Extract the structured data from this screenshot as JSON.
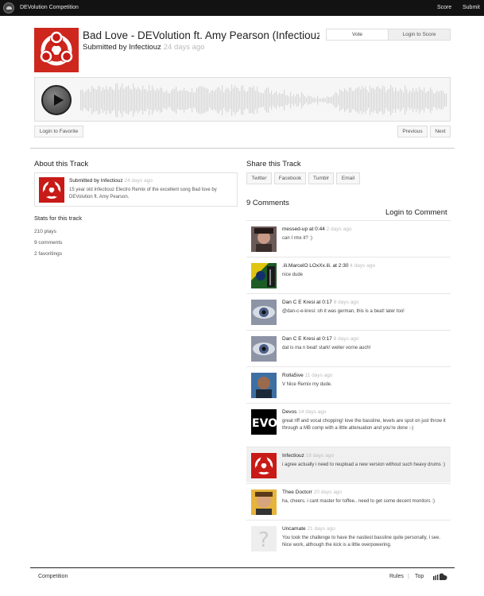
{
  "topbar": {
    "title": "DEVolution Competition",
    "score": "Score",
    "submit": "Submit"
  },
  "track": {
    "title": "Bad Love - DEVolution ft. Amy Pearson (Infectiouz",
    "submitted_by": "Submitted by Infectiouz",
    "submitted_ago": "24 days ago"
  },
  "vote_box": {
    "vote": "Vote",
    "login_score": "Login to Score"
  },
  "player": {
    "favorite": "Login to Favorite",
    "previous": "Previous",
    "next": "Next"
  },
  "about": {
    "heading": "About this Track",
    "who": "Submitted by Infectiouz",
    "ago": "24 days ago",
    "description": "15 year old Infectiouz Electro Remix of the excellent song Bad love by DEVolution ft. Amy Pearson."
  },
  "stats": {
    "heading": "Stats for this track",
    "plays": "210 plays",
    "comments": "9 comments",
    "favoritings": "2 favoritings"
  },
  "share": {
    "heading": "Share this Track",
    "twitter": "Twitter",
    "facebook": "Facebook",
    "tumblr": "Tumblr",
    "email": "Email"
  },
  "comments_section": {
    "heading": "9 Comments",
    "login": "Login to Comment"
  },
  "comments": [
    {
      "who": "messed-up at 0:44",
      "ago": "2 days ago",
      "text": "can I rmx it? :)"
    },
    {
      "who": ".ili.MarcelO LOxXx.ili. at 2:30",
      "ago": "4 days ago",
      "text": "nice dude"
    },
    {
      "who": "Dan C E Kresi at 0:17",
      "ago": "8 days ago",
      "text": "@dan-c-e-kresi: oh it was german, this is a beat! later too!"
    },
    {
      "who": "Dan C E Kresi at 0:17",
      "ago": "8 days ago",
      "text": "dat is ma n beat! stark! weiter vorne auch!"
    },
    {
      "who": "Rolla5ive",
      "ago": "11 days ago",
      "text": "V Nice Remix my dude."
    },
    {
      "who": "Devos",
      "ago": "14 days ago",
      "text": "great riff and vocal chopping! love the bassline, levels are spot on just throw it through a MB comp with a little attenuation and you're done :-)"
    },
    {
      "who": "Infectiouz",
      "ago": "18 days ago",
      "text": "i agree actually i need to reupload a new version without such heavy drums :)"
    },
    {
      "who": "Thee Doctorr",
      "ago": "20 days ago",
      "text": "ha, cheers. i cant master for toffee.. need to get some decent monitors :)"
    },
    {
      "who": "Uncamate",
      "ago": "21 days ago",
      "text": "You took the challenge to have the nastiest bassline quite personally, I see. Nice work, although the kick is a little overpowering."
    }
  ],
  "footer": {
    "competition": "Competition",
    "rules": "Rules",
    "top": "Top"
  }
}
